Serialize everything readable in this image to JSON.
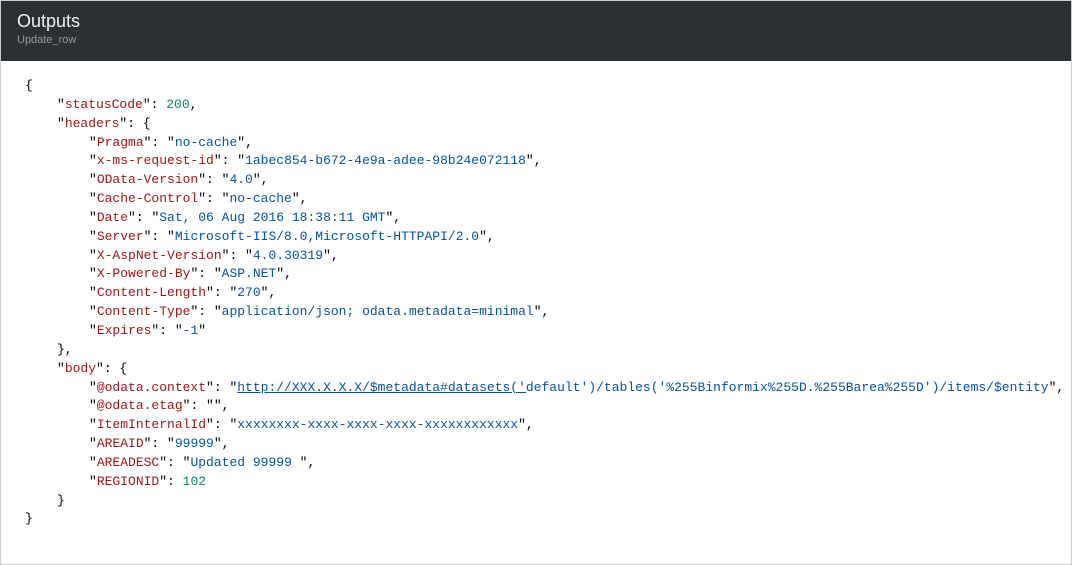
{
  "header": {
    "title": "Outputs",
    "subtitle": "Update_row"
  },
  "json": {
    "statusCode": 200,
    "headers": {
      "Pragma": "no-cache",
      "x-ms-request-id": "1abec854-b672-4e9a-adee-98b24e072118",
      "OData-Version": "4.0",
      "Cache-Control": "no-cache",
      "Date": "Sat, 06 Aug 2016 18:38:11 GMT",
      "Server": "Microsoft-IIS/8.0,Microsoft-HTTPAPI/2.0",
      "X-AspNet-Version": "4.0.30319",
      "X-Powered-By": "ASP.NET",
      "Content-Length": "270",
      "Content-Type": "application/json; odata.metadata=minimal",
      "Expires": "-1"
    },
    "body": {
      "odata_context_link": "http://XXX.X.X.X/$metadata#datasets('",
      "odata_context_trailing": "default')/tables('%255Binformix%255D.%255Barea%255D')/items/$entity",
      "odata_etag": "",
      "ItemInternalId": "xxxxxxxx-xxxx-xxxx-xxxx-xxxxxxxxxxxx",
      "AREAID": "99999",
      "AREADESC": "Updated 99999 ",
      "REGIONID": 102
    }
  },
  "keys": {
    "statusCode": "statusCode",
    "headers": "headers",
    "Pragma": "Pragma",
    "x_ms_request_id": "x-ms-request-id",
    "OData_Version": "OData-Version",
    "Cache_Control": "Cache-Control",
    "Date": "Date",
    "Server": "Server",
    "X_AspNet_Version": "X-AspNet-Version",
    "X_Powered_By": "X-Powered-By",
    "Content_Length": "Content-Length",
    "Content_Type": "Content-Type",
    "Expires": "Expires",
    "body": "body",
    "odata_context": "@odata.context",
    "odata_etag": "@odata.etag",
    "ItemInternalId": "ItemInternalId",
    "AREAID": "AREAID",
    "AREADESC": "AREADESC",
    "REGIONID": "REGIONID"
  }
}
